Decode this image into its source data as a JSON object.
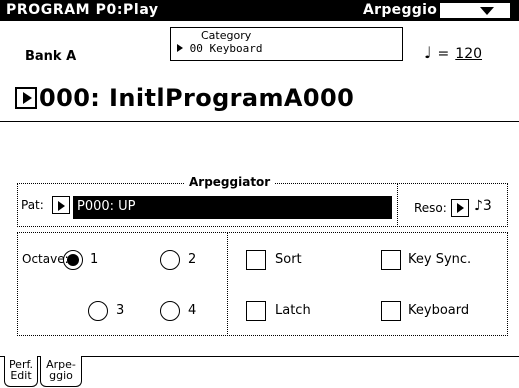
{
  "header": {
    "title": "PROGRAM P0:Play",
    "mode_label": "Arpeggio"
  },
  "program": {
    "bank": "Bank A",
    "category_label": "Category",
    "category_value": "00 Keyboard",
    "tempo_value": "120",
    "tempo_note_icon": "quarter-note-icon",
    "name": "000: InitlProgramA000"
  },
  "arpeggiator": {
    "section_label": "Arpeggiator",
    "pattern_label": "Pat:",
    "pattern_value": "P000: UP",
    "reso_label": "Reso:",
    "reso_value": "♪3",
    "octave_label": "Octave:",
    "octave_options": [
      "1",
      "2",
      "3",
      "4"
    ],
    "octave_selected": "1",
    "sort_label": "Sort",
    "latch_label": "Latch",
    "key_sync_label": "Key Sync.",
    "keyboard_label": "Keyboard"
  },
  "tabs": {
    "perf_edit_line1": "Perf.",
    "perf_edit_line2": "Edit",
    "arpeggio_line1": "Arpe-",
    "arpeggio_line2": "ggio"
  }
}
